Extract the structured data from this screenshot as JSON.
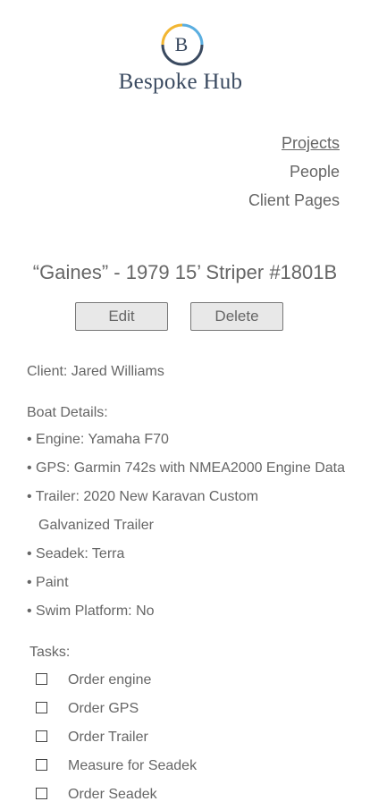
{
  "brand": {
    "name": "Bespoke Hub",
    "initial": "B"
  },
  "nav": {
    "items": [
      "Projects",
      "People",
      "Client Pages"
    ]
  },
  "project": {
    "title": "“Gaines” - 1979 15’ Striper #1801B",
    "edit_label": "Edit",
    "delete_label": "Delete",
    "client": "Client: Jared Williams",
    "details_heading": "Boat Details:",
    "details": [
      "• Engine: Yamaha F70",
      "• GPS: Garmin 742s with NMEA2000 Engine Data",
      "• Trailer: 2020 New Karavan Custom",
      "Galvanized Trailer",
      "• Seadek: Terra",
      "• Paint",
      "• Swim Platform: No"
    ],
    "tasks_heading": "Tasks:",
    "tasks": [
      "Order engine",
      "Order GPS",
      "Order Trailer",
      "Measure for Seadek",
      "Order Seadek"
    ]
  },
  "colors": {
    "logo_blue": "#3a4a60",
    "logo_yellow": "#f2b632",
    "logo_sky": "#5aaee0",
    "text": "#666666"
  }
}
